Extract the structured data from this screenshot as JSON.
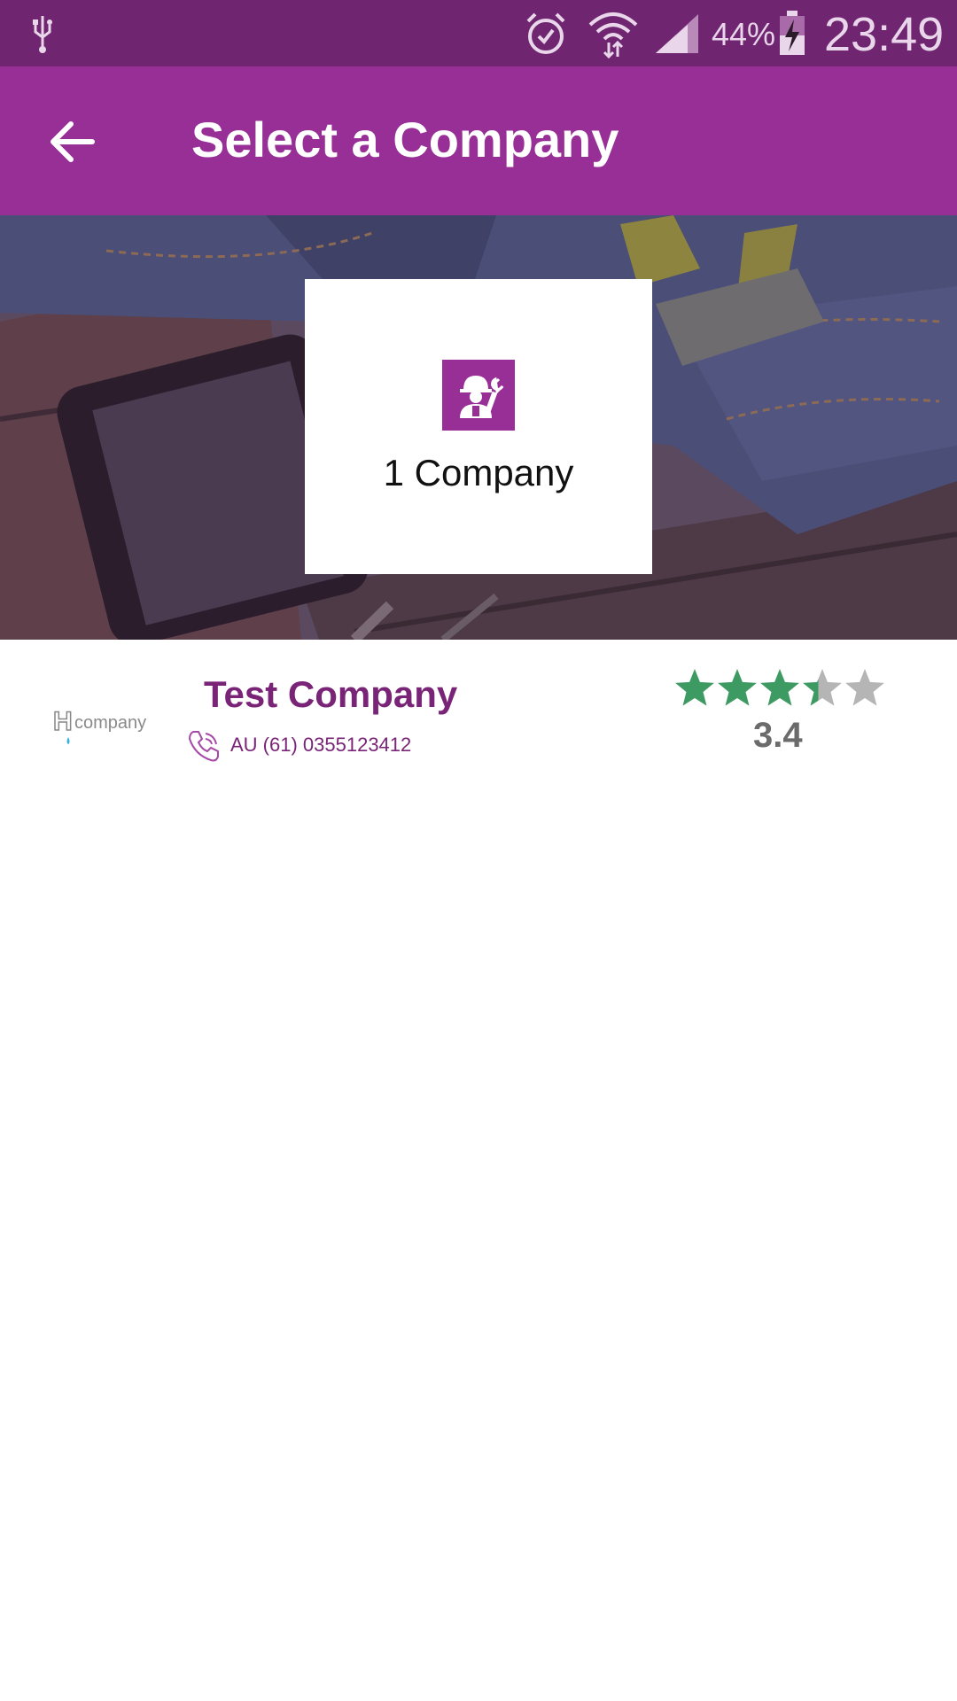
{
  "status_bar": {
    "battery_percent": "44%",
    "time": "23:49",
    "icons": [
      "usb-icon",
      "alarm-icon",
      "wifi-icon",
      "signal-icon",
      "battery-charging-icon"
    ]
  },
  "app_bar": {
    "title": "Select a Company",
    "back_icon": "arrow-back-icon"
  },
  "summary_card": {
    "icon": "worker-wrench-icon",
    "count_label": "1 Company"
  },
  "companies": [
    {
      "name": "Test Company",
      "phone": "AU (61) 0355123412",
      "rating": 3.4,
      "rating_label": "3.4",
      "max_rating": 5
    }
  ],
  "colors": {
    "status_bar": "#6f2570",
    "app_bar": "#982f97",
    "accent": "#7a2478",
    "star_filled": "#3e9a63",
    "star_empty": "#b5b5b5"
  }
}
